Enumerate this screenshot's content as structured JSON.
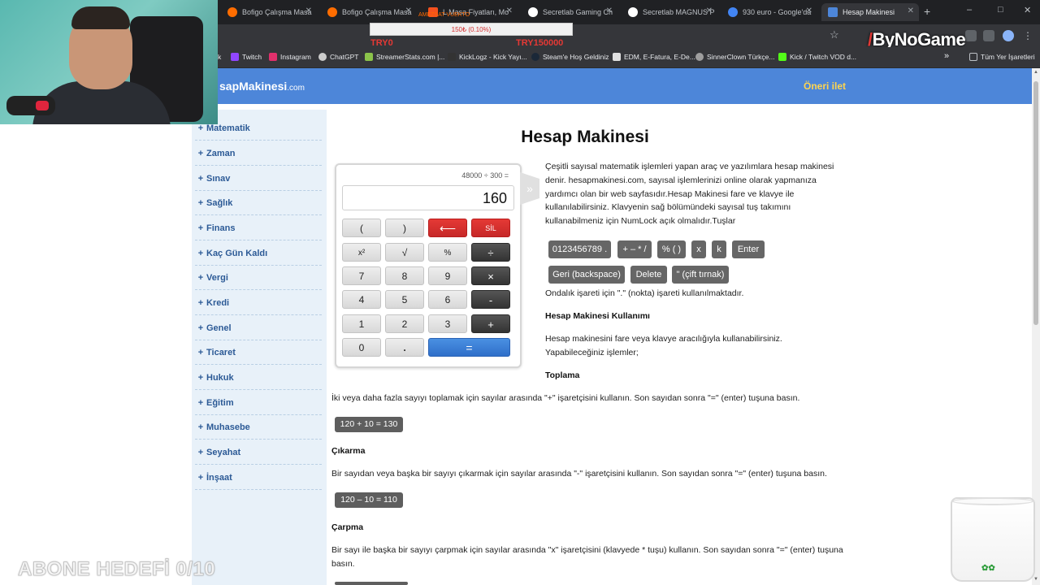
{
  "browser": {
    "tabs": [
      {
        "label": "Bofigo Çalışma Masa",
        "icon_color": "#ff6d00"
      },
      {
        "label": "Bofigo Çalışma Masa",
        "icon_color": "#ff6d00"
      },
      {
        "label": "L Masa Fiyatları, Mo",
        "icon_color": "#f4511e"
      },
      {
        "label": "Secretlab Gaming Ch",
        "icon_color": "#ffffff"
      },
      {
        "label": "Secretlab MAGNUS P",
        "icon_color": "#ffffff"
      },
      {
        "label": "930 euro - Google'da",
        "icon_color": "#4285f4"
      },
      {
        "label": "Hesap Makinesi",
        "icon_color": "#4d86d9"
      }
    ],
    "new_tab_glyph": "+",
    "window_controls": {
      "minimize": "–",
      "maximize": "□",
      "close": "✕"
    },
    "star_glyph": "☆",
    "bookmarks": [
      {
        "label": "k",
        "icon_color": "#35363a"
      },
      {
        "label": "Twitch",
        "icon_color": "#9146ff"
      },
      {
        "label": "Instagram",
        "icon_color": "#e1306c"
      },
      {
        "label": "ChatGPT",
        "icon_color": "#cccccc"
      },
      {
        "label": "StreamerStats.com |...",
        "icon_color": "#8bc34a"
      },
      {
        "label": "KickLogz - Kick Yayı...",
        "icon_color": "#333333"
      },
      {
        "label": "Steam'e Hoş Geldiniz",
        "icon_color": "#1b2838"
      },
      {
        "label": "EDM, E-Fatura, E-De...",
        "icon_color": "#e0e0e0"
      },
      {
        "label": "SinnerClown Türkçe...",
        "icon_color": "#9e9e9e"
      },
      {
        "label": "Kick / Twitch VOD d...",
        "icon_color": "#53fc18"
      },
      {
        "label": "»",
        "icon_color": "#35363a"
      },
      {
        "label": "Tüm Yer İşaretleri",
        "icon_color": "#bdc1c6"
      }
    ]
  },
  "stream_overlay": {
    "top_text": "AMEZSAT  VUEKTO",
    "box_text": "150₺ (0.10%)",
    "left_text": "TRY0",
    "right_text": "TRY150000",
    "logo_text": "ByNoGame",
    "goal_text": "ABONE HEDEFİ 0/10",
    "jar_text": "✿✿"
  },
  "site": {
    "logo_main": "sapMakinesi",
    "logo_domain": ".com",
    "suggest_link": "Öneri ilet"
  },
  "sidebar": {
    "items": [
      {
        "label": "Matematik"
      },
      {
        "label": "Zaman"
      },
      {
        "label": "Sınav"
      },
      {
        "label": "Sağlık"
      },
      {
        "label": "Finans"
      },
      {
        "label": "Kaç Gün Kaldı"
      },
      {
        "label": "Vergi"
      },
      {
        "label": "Kredi"
      },
      {
        "label": "Genel"
      },
      {
        "label": "Ticaret"
      },
      {
        "label": "Hukuk"
      },
      {
        "label": "Eğitim"
      },
      {
        "label": "Muhasebe"
      },
      {
        "label": "Seyahat"
      },
      {
        "label": "İnşaat"
      }
    ]
  },
  "main": {
    "title": "Hesap Makinesi",
    "calculator": {
      "expression": "48000 ÷ 300 =",
      "display": "160",
      "panel_toggle": "»",
      "keys": {
        "open_paren": "(",
        "close_paren": ")",
        "backspace": "⟵",
        "clear": "SİL",
        "square": "x²",
        "sqrt": "√",
        "percent": "%",
        "divide": "÷",
        "seven": "7",
        "eight": "8",
        "nine": "9",
        "multiply": "×",
        "four": "4",
        "five": "5",
        "six": "6",
        "minus": "-",
        "one": "1",
        "two": "2",
        "three": "3",
        "plus": "+",
        "zero": "0",
        "dot": ".",
        "equals": "="
      }
    },
    "intro": "Çeşitli sayısal matematik işlemleri yapan araç ve yazılımlara hesap makinesi denir. hesapmakinesi.com, sayısal işlemlerinizi online olarak yapmanıza yardımcı olan bir web sayfasıdır.Hesap Makinesi fare ve klavye ile kullanılabilirsiniz. Klavyenin sağ bölümündeki sayısal tuş takımını kullanabilmeniz için NumLock açık olmalıdır.Tuşlar",
    "key_chips": {
      "digits": "0123456789 .",
      "ops": "+ – * /",
      "percent_paren": "% ( )",
      "x": "x",
      "k": "k",
      "enter": "Enter",
      "backspace": "Geri (backspace)",
      "delete": "Delete",
      "quote": "\" (çift tırnak)"
    },
    "decimal_note": "Ondalık işareti için \".\" (nokta) işareti kullanılmaktadır.",
    "usage_heading": "Hesap Makinesi Kullanımı",
    "usage_text": "Hesap makinesini fare veya klavye aracılığıyla kullanabilirsiniz. Yapabileceğiniz işlemler;",
    "sections": {
      "add_heading": "Toplama",
      "add_text": "İki veya daha fazla sayıyı toplamak için sayılar arasında \"+\" işaretçisini kullanın. Son sayıdan sonra \"=\" (enter) tuşuna basın.",
      "add_example": "120 + 10 = 130",
      "sub_heading": "Çıkarma",
      "sub_text": "Bir sayıdan veya başka bir sayıyı çıkarmak için sayılar arasında \"-\" işaretçisini kullanın. Son sayıdan sonra \"=\" (enter) tuşuna basın.",
      "sub_example": "120 – 10 = 110",
      "mul_heading": "Çarpma",
      "mul_text": "Bir sayı ile başka bir sayıyı çarpmak için sayılar arasında \"x\" işaretçisini (klavyede * tuşu) kullanın. Son sayıdan sonra \"=\" (enter) tuşuna basın."
    }
  }
}
